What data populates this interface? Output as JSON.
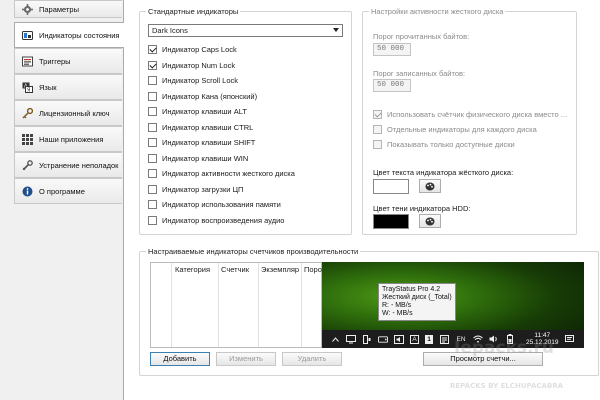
{
  "sidebar": {
    "items": [
      {
        "label": "Параметры",
        "icon": "gear-icon"
      },
      {
        "label": "Индикаторы состояния",
        "icon": "indicator-icon",
        "active": true
      },
      {
        "label": "Триггеры",
        "icon": "trigger-icon"
      },
      {
        "label": "Язык",
        "icon": "language-icon"
      },
      {
        "label": "Лицензионный ключ",
        "icon": "key-icon"
      },
      {
        "label": "Наши приложения",
        "icon": "apps-grid-icon"
      },
      {
        "label": "Устранение неполадок",
        "icon": "troubleshoot-icon"
      },
      {
        "label": "О программе",
        "icon": "info-icon"
      }
    ]
  },
  "standard": {
    "title": "Стандартные индикаторы",
    "theme": "Dark Icons",
    "items": [
      {
        "label": "Индикатор Caps Lock",
        "checked": true
      },
      {
        "label": "Индикатор Num Lock",
        "checked": true
      },
      {
        "label": "Индикатор Scroll Lock",
        "checked": false
      },
      {
        "label": "Индикатор Кана (японский)",
        "checked": false
      },
      {
        "label": "Индикатор клавиши ALT",
        "checked": false
      },
      {
        "label": "Индикатор клавиши CTRL",
        "checked": false
      },
      {
        "label": "Индикатор клавиши SHIFT",
        "checked": false
      },
      {
        "label": "Индикатор клавиши WIN",
        "checked": false
      },
      {
        "label": "Индикатор активности жесткого диска",
        "checked": false
      },
      {
        "label": "Индикатор загрузки ЦП",
        "checked": false
      },
      {
        "label": "Индикатор использования памяти",
        "checked": false
      },
      {
        "label": "Индикатор воспроизведения аудио",
        "checked": false
      }
    ]
  },
  "disk": {
    "title": "Настройки активности жесткого диска",
    "read_label": "Порог прочитанных байтов:",
    "read_value": "50 000",
    "write_label": "Порог записанных байтов:",
    "write_value": "50 000",
    "options": [
      {
        "label": "Использовать счётчик физического диска вместо ...",
        "checked": true
      },
      {
        "label": "Отдельные индикаторы для каждого диска",
        "checked": false
      },
      {
        "label": "Показывать только доступные диски",
        "checked": false
      }
    ],
    "text_color_label": "Цвет текста индикатора жёсткого диска:",
    "text_color": "#ffffff",
    "shadow_color_label": "Цвет тени индикатора HDD:",
    "shadow_color": "#000000"
  },
  "perf": {
    "title": "Настраиваемые индикаторы счетчиков производительности",
    "columns": [
      "Категория",
      "Счетчик",
      "Экземпляр",
      "Порог"
    ],
    "add_label": "Добавить",
    "edit_label": "Изменить",
    "delete_label": "Удалить",
    "browse_label": "Просмотр счетчиков...",
    "browse_visible": "Просмотр счетчи..."
  },
  "preview": {
    "tooltip": [
      "TrayStatus Pro 4.2",
      "Жесткий диск (_Total)",
      "R: - MB/s",
      "W: - MB/s"
    ],
    "tray_icons": [
      "desktop-icon",
      "tray-bracket-icon",
      "drive-icon",
      "speaker-icon",
      "keyboard-a-icon",
      "num-1-icon",
      "notes-icon",
      "lang-label",
      "wifi-icon",
      "volume-icon",
      "battery-icon"
    ],
    "lang": "EN",
    "a_label": "A",
    "num_label": "1",
    "time": "11:47",
    "date": "25.12.2019"
  },
  "watermark": {
    "site": "Iepacks.ru",
    "credit": "REPACKS BY ELCHUPACABRA"
  },
  "colors": {
    "accent": "#3c7fb1"
  }
}
